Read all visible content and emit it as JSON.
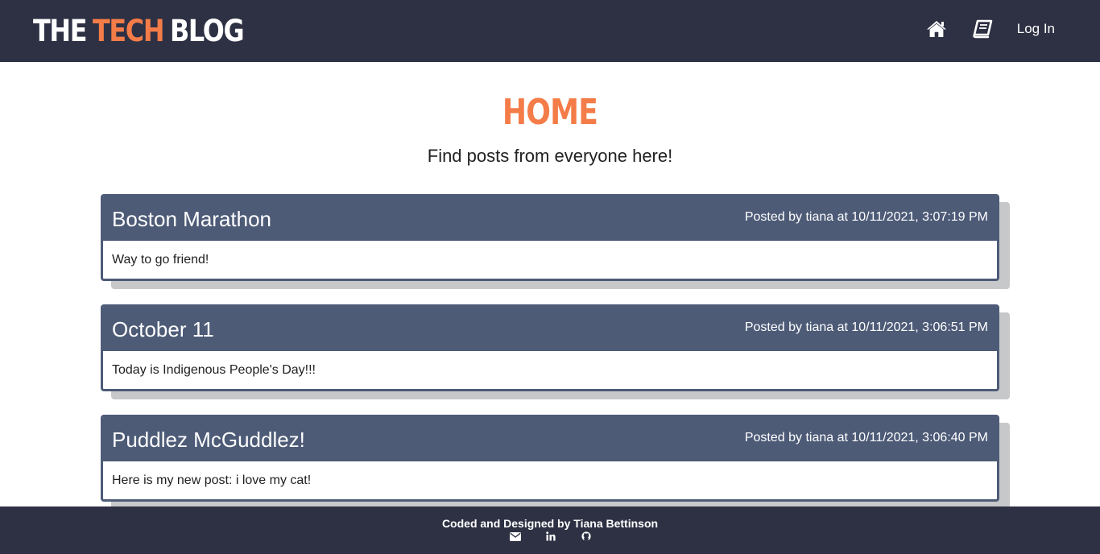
{
  "header": {
    "logo": {
      "part1": "THE",
      "part2": "TECH",
      "part3": "BLOG"
    },
    "nav": [
      {
        "icon": "home-icon"
      },
      {
        "icon": "book-icon"
      },
      {
        "label": "Log In"
      }
    ]
  },
  "main": {
    "title": "HOME",
    "subtitle": "Find posts from everyone here!",
    "posts": [
      {
        "title": "Boston Marathon",
        "meta": "Posted by tiana at 10/11/2021, 3:07:19 PM",
        "body": "Way to go friend!"
      },
      {
        "title": "October 11",
        "meta": "Posted by tiana at 10/11/2021, 3:06:51 PM",
        "body": "Today is Indigenous People's Day!!!"
      },
      {
        "title": "Puddlez McGuddlez!",
        "meta": "Posted by tiana at 10/11/2021, 3:06:40 PM",
        "body": "Here is my new post: i love my cat!"
      }
    ]
  },
  "footer": {
    "credit": "Coded and Designed by Tiana Bettinson",
    "icons": [
      "mail-icon",
      "linkedin-icon",
      "github-icon"
    ]
  },
  "colors": {
    "header_bg": "#2e3144",
    "accent": "#f47c48",
    "card_header": "#4d5b77",
    "shadow": "#c7c8ca"
  }
}
